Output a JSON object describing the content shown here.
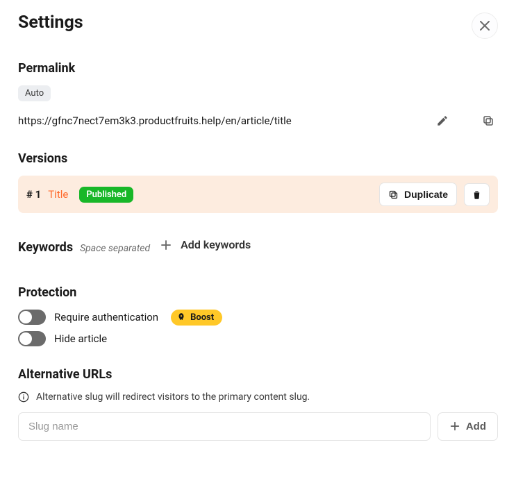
{
  "page": {
    "title": "Settings"
  },
  "permalink": {
    "heading": "Permalink",
    "mode_badge": "Auto",
    "url": "https://gfnc7nect7em3k3.productfruits.help/en/article/title"
  },
  "versions": {
    "heading": "Versions",
    "items": [
      {
        "num": "# 1",
        "title": "Title",
        "status": "Published",
        "duplicate_label": "Duplicate"
      }
    ]
  },
  "keywords": {
    "heading": "Keywords",
    "hint": "Space separated",
    "add_label": "Add keywords"
  },
  "protection": {
    "heading": "Protection",
    "require_auth_label": "Require authentication",
    "hide_article_label": "Hide article",
    "boost_label": "Boost"
  },
  "alt_urls": {
    "heading": "Alternative URLs",
    "info": "Alternative slug will redirect visitors to the primary content slug.",
    "placeholder": "Slug name",
    "add_label": "Add"
  }
}
